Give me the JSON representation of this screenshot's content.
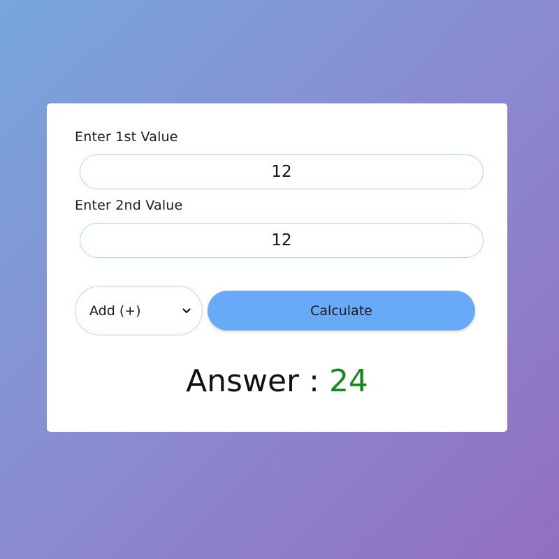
{
  "form": {
    "first_label": "Enter 1st Value",
    "first_value": "12",
    "second_label": "Enter 2nd Value",
    "second_value": "12",
    "operation_selected": "Add (+)",
    "calculate_label": "Calculate"
  },
  "result": {
    "label": "Answer :",
    "value": "24"
  },
  "colors": {
    "button_bg": "#69aaf8",
    "answer_value": "#138a18",
    "input_border": "#a9d9ea",
    "select_border": "#f2bfd0"
  },
  "icons": {
    "select_arrow": "chevron-down-icon"
  }
}
